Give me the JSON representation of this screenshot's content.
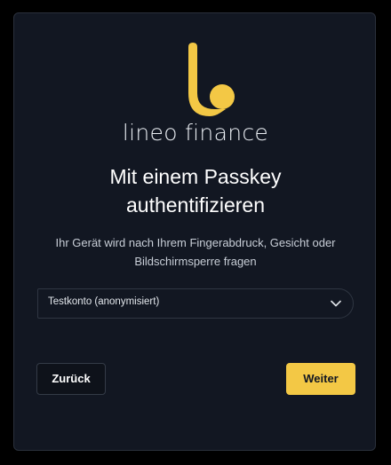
{
  "brand": {
    "name": "lineo finance",
    "logo_icon": "lineo-logo-icon",
    "accent_color": "#f3c845"
  },
  "main": {
    "title": "Mit einem Passkey authentifizieren",
    "description": "Ihr Gerät wird nach Ihrem Fingerabdruck, Gesicht oder Bildschirmsperre fragen"
  },
  "account_select": {
    "value": "Testkonto (anonymisiert)",
    "icon": "chevron-down-icon"
  },
  "actions": {
    "back_label": "Zurück",
    "next_label": "Weiter"
  }
}
